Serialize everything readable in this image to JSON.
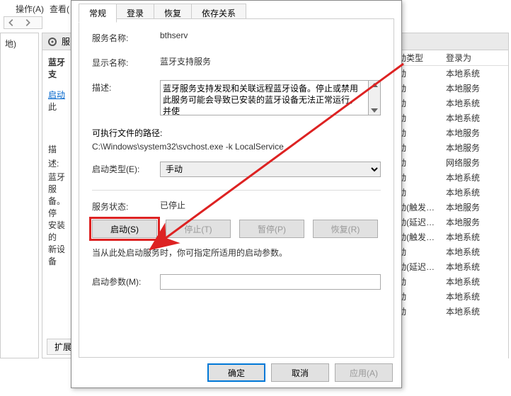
{
  "bg": {
    "menu": {
      "action": "操作(A)",
      "view": "查看("
    },
    "sidebar": {
      "label": "地)"
    },
    "panel_head": "服",
    "left": {
      "title": "蓝牙支",
      "link": "启动",
      "link_tail": "此",
      "desc_hdr": "描述:",
      "desc": "蓝牙服\n备。停\n安装的\n新设备"
    },
    "headers": {
      "start": "动类型",
      "logon": "登录为"
    },
    "rows": [
      {
        "c1": "动",
        "c2": "本地系统"
      },
      {
        "c1": "动",
        "c2": "本地服务"
      },
      {
        "c1": "动",
        "c2": "本地系统"
      },
      {
        "c1": "动",
        "c2": "本地系统"
      },
      {
        "c1": "动",
        "c2": "本地服务"
      },
      {
        "c1": "动",
        "c2": "本地服务"
      },
      {
        "c1": "动",
        "c2": "网络服务"
      },
      {
        "c1": "动",
        "c2": "本地系统"
      },
      {
        "c1": "动",
        "c2": "本地系统"
      },
      {
        "c1": "动(触发…",
        "c2": "本地服务"
      },
      {
        "c1": "动(延迟…",
        "c2": "本地服务"
      },
      {
        "c1": "动(触发…",
        "c2": "本地系统"
      },
      {
        "c1": "动",
        "c2": "本地系统"
      },
      {
        "c1": "动(延迟…",
        "c2": "本地系统"
      },
      {
        "c1": "动",
        "c2": "本地系统"
      },
      {
        "c1": "动",
        "c2": "本地系统"
      },
      {
        "c1": "动",
        "c2": "本地系统"
      }
    ],
    "tabs": {
      "ext": "扩展"
    }
  },
  "dialog": {
    "tabs": {
      "general": "常规",
      "logon": "登录",
      "recovery": "恢复",
      "deps": "依存关系"
    },
    "labels": {
      "svcname": "服务名称:",
      "dispname": "显示名称:",
      "desc": "描述:",
      "exepath": "可执行文件的路径:",
      "startup": "启动类型(E):",
      "status": "服务状态:",
      "params": "启动参数(M):"
    },
    "values": {
      "svcname": "bthserv",
      "dispname": "蓝牙支持服务",
      "desc": "蓝牙服务支持发现和关联远程蓝牙设备。停止或禁用此服务可能会导致已安装的蓝牙设备无法正常运行，并使",
      "exepath": "C:\\Windows\\system32\\svchost.exe -k LocalService",
      "startup": "手动",
      "status": "已停止",
      "params": ""
    },
    "buttons": {
      "start": "启动(S)",
      "stop": "停止(T)",
      "pause": "暂停(P)",
      "resume": "恢复(R)"
    },
    "hint": "当从此处启动服务时，你可指定所适用的启动参数。",
    "ok": "确定",
    "cancel": "取消",
    "apply": "应用(A)"
  }
}
